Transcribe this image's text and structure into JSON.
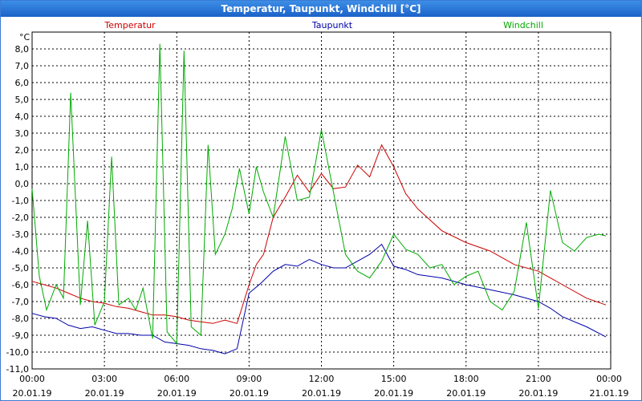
{
  "window": {
    "title": "Temperatur, Taupunkt, Windchill [°C]"
  },
  "chart_data": {
    "type": "line",
    "title": "Temperatur, Taupunkt, Windchill [°C]",
    "ylabel": "°C",
    "ylim": [
      -11.0,
      9.0
    ],
    "xlim": [
      "2019-01-20 00:00",
      "2019-01-21 00:00"
    ],
    "grid": true,
    "legend_placement": "top",
    "y_ticks": [
      "8,0",
      "7,0",
      "6,0",
      "5,0",
      "4,0",
      "3,0",
      "2,0",
      "1,0",
      "0,0",
      "-1,0",
      "-2,0",
      "-3,0",
      "-4,0",
      "-5,0",
      "-6,0",
      "-7,0",
      "-8,0",
      "-9,0",
      "-10,0",
      "-11,0"
    ],
    "x_ticks": [
      {
        "time": "00:00",
        "date": "20.01.19"
      },
      {
        "time": "03:00",
        "date": "20.01.19"
      },
      {
        "time": "06:00",
        "date": "20.01.19"
      },
      {
        "time": "09:00",
        "date": "20.01.19"
      },
      {
        "time": "12:00",
        "date": "20.01.19"
      },
      {
        "time": "15:00",
        "date": "20.01.19"
      },
      {
        "time": "18:00",
        "date": "20.01.19"
      },
      {
        "time": "21:00",
        "date": "20.01.19"
      },
      {
        "time": "00:00",
        "date": "21.01.19"
      }
    ],
    "series": [
      {
        "name": "Temperatur",
        "color": "#cc0000",
        "x_hours": [
          0,
          0.5,
          1,
          1.5,
          2,
          2.5,
          3,
          3.5,
          4,
          4.5,
          5,
          5.5,
          6,
          6.5,
          7,
          7.5,
          8,
          8.5,
          9,
          9.3,
          9.6,
          10,
          10.5,
          11,
          11.5,
          12,
          12.5,
          13,
          13.5,
          14,
          14.5,
          15,
          15.5,
          16,
          17,
          18,
          19,
          20,
          21,
          21.5,
          22,
          23,
          23.8
        ],
        "values": [
          -5.8,
          -6.0,
          -6.2,
          -6.5,
          -6.8,
          -7.0,
          -7.1,
          -7.3,
          -7.4,
          -7.6,
          -7.8,
          -7.8,
          -7.9,
          -8.1,
          -8.2,
          -8.3,
          -8.1,
          -8.3,
          -6.0,
          -4.8,
          -4.2,
          -2.0,
          -0.8,
          0.5,
          -0.5,
          0.6,
          -0.3,
          -0.2,
          1.1,
          0.4,
          2.3,
          1.0,
          -0.6,
          -1.5,
          -2.8,
          -3.5,
          -4.0,
          -4.8,
          -5.2,
          -5.6,
          -6.0,
          -6.8,
          -7.2
        ]
      },
      {
        "name": "Taupunkt",
        "color": "#0000aa",
        "x_hours": [
          0,
          0.5,
          1,
          1.5,
          2,
          2.5,
          3,
          3.5,
          4,
          4.5,
          5,
          5.5,
          6,
          6.5,
          7,
          7.5,
          8,
          8.5,
          9,
          9.5,
          10,
          10.5,
          11,
          11.5,
          12,
          12.5,
          13,
          13.5,
          14,
          14.5,
          15,
          15.5,
          16,
          17,
          18,
          19,
          20,
          21,
          21.5,
          22,
          23,
          23.8
        ],
        "values": [
          -7.7,
          -7.9,
          -8.0,
          -8.4,
          -8.6,
          -8.5,
          -8.7,
          -8.9,
          -8.9,
          -9.0,
          -9.0,
          -9.4,
          -9.5,
          -9.6,
          -9.8,
          -9.9,
          -10.1,
          -9.8,
          -6.5,
          -5.9,
          -5.2,
          -4.8,
          -4.9,
          -4.5,
          -4.8,
          -5.0,
          -5.0,
          -4.6,
          -4.2,
          -3.6,
          -4.9,
          -5.1,
          -5.4,
          -5.6,
          -6.0,
          -6.3,
          -6.6,
          -7.0,
          -7.4,
          -7.9,
          -8.5,
          -9.1
        ]
      },
      {
        "name": "Windchill",
        "color": "#00aa00",
        "x_hours": [
          0,
          0.3,
          0.6,
          1,
          1.3,
          1.6,
          2,
          2.3,
          2.6,
          3,
          3.3,
          3.6,
          4,
          4.3,
          4.6,
          5,
          5.3,
          5.6,
          6,
          6.3,
          6.6,
          7,
          7.3,
          7.6,
          8,
          8.3,
          8.6,
          9,
          9.3,
          9.6,
          10,
          10.5,
          11,
          11.5,
          12,
          12.5,
          13,
          13.5,
          14,
          14.5,
          15,
          15.5,
          16,
          16.5,
          17,
          17.5,
          18,
          18.5,
          19,
          19.5,
          20,
          20.5,
          21,
          21.5,
          22,
          22.5,
          23,
          23.5,
          23.8
        ],
        "values": [
          -0.3,
          -5.5,
          -7.5,
          -6.0,
          -6.8,
          5.4,
          -7.2,
          -2.2,
          -8.4,
          -7.0,
          1.6,
          -7.2,
          -6.8,
          -7.5,
          -6.2,
          -9.2,
          8.3,
          -8.8,
          -9.5,
          7.9,
          -8.5,
          -9.0,
          2.3,
          -4.2,
          -3.0,
          -1.5,
          0.9,
          -1.8,
          1.0,
          -0.5,
          -2.0,
          2.8,
          -1.0,
          -0.8,
          3.2,
          -0.5,
          -4.2,
          -5.2,
          -5.6,
          -4.6,
          -3.0,
          -3.9,
          -4.2,
          -5.0,
          -4.8,
          -6.0,
          -5.5,
          -5.2,
          -7.0,
          -7.5,
          -6.4,
          -2.3,
          -7.4,
          -0.4,
          -3.5,
          -4.0,
          -3.2,
          -3.0,
          -3.1
        ]
      }
    ]
  }
}
